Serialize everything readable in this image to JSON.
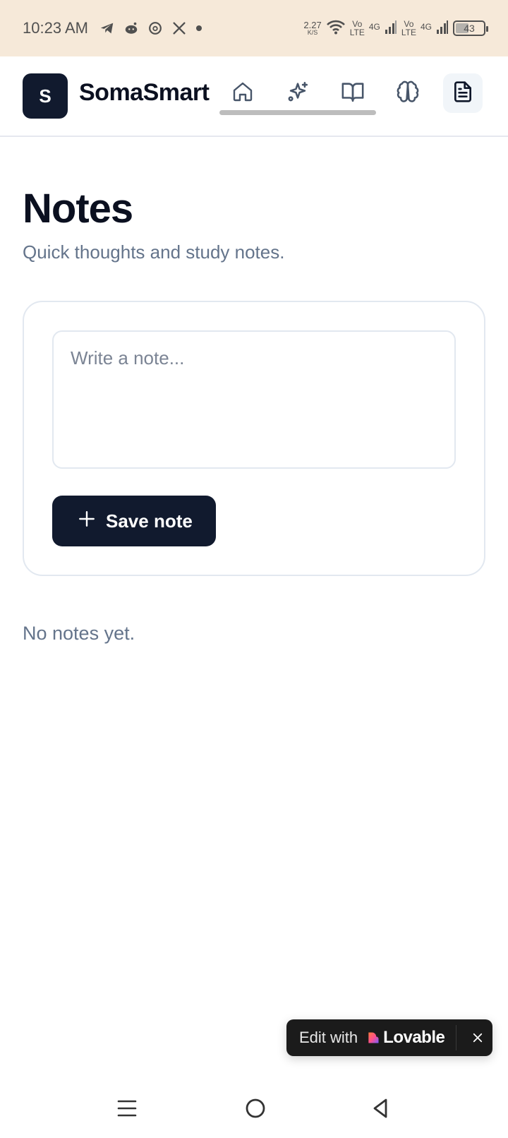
{
  "status_bar": {
    "time": "10:23 AM",
    "net_speed_value": "2.27",
    "net_speed_unit": "K/S",
    "volte_top": "Vo",
    "volte_bottom": "LTE",
    "network_type": "4G",
    "battery_level": "43",
    "left_icons": [
      "telegram-icon",
      "reddit-icon",
      "threads-icon",
      "x-icon",
      "dot-icon"
    ],
    "right_icons": [
      "wifi-icon",
      "signal-icon",
      "battery-icon"
    ]
  },
  "header": {
    "logo_letter": "S",
    "brand_name": "SomaSmart",
    "nav_items": [
      {
        "icon": "home-icon"
      },
      {
        "icon": "sparkles-icon"
      },
      {
        "icon": "book-open-icon"
      },
      {
        "icon": "brain-icon"
      },
      {
        "icon": "file-text-icon",
        "active": true
      }
    ]
  },
  "main": {
    "title": "Notes",
    "subtitle": "Quick thoughts and study notes.",
    "note_input": {
      "value": "",
      "placeholder": "Write a note..."
    },
    "save_button_label": "Save note",
    "empty_message": "No notes yet."
  },
  "lovable_badge": {
    "prefix": "Edit with",
    "brand": "Lovable"
  },
  "colors": {
    "primary": "#111a2e",
    "muted_text": "#64748b",
    "border": "#e2e8f0",
    "status_bar_bg": "#f6e9d9"
  }
}
